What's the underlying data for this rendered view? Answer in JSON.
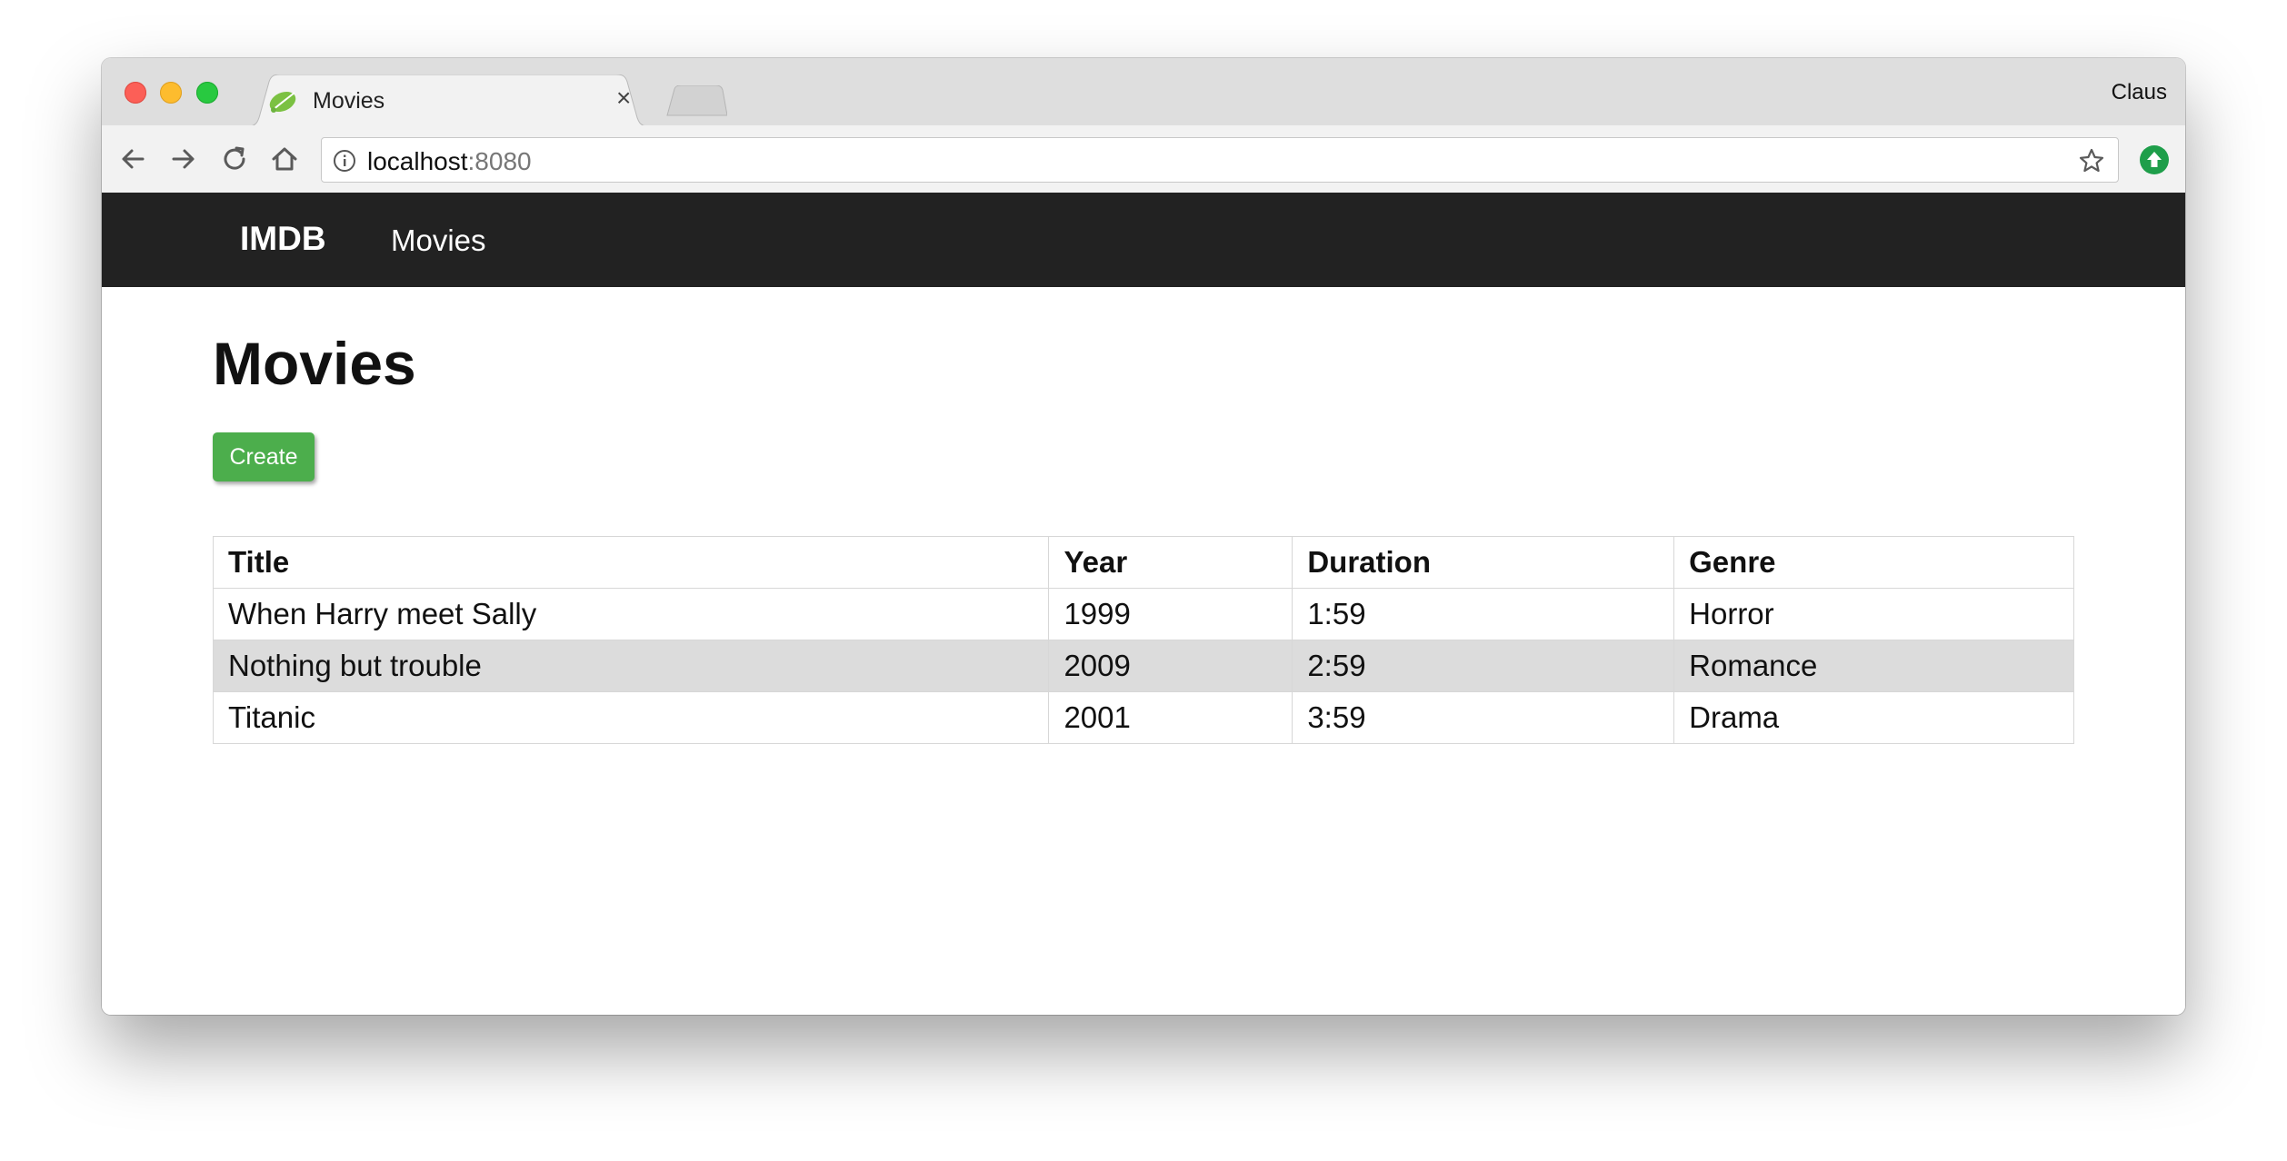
{
  "browser": {
    "tab": {
      "title": "Movies",
      "close_glyph": "×",
      "favicon": "spring-leaf-icon"
    },
    "profile_name": "Claus",
    "address": {
      "host": "localhost",
      "port": ":8080"
    }
  },
  "navbar": {
    "brand": "IMDB",
    "links": [
      {
        "label": "Movies"
      }
    ]
  },
  "main": {
    "title": "Movies",
    "create_label": "Create",
    "table": {
      "headers": [
        "Title",
        "Year",
        "Duration",
        "Genre"
      ],
      "rows": [
        [
          "When Harry meet Sally",
          "1999",
          "1:59",
          "Horror"
        ],
        [
          "Nothing but trouble",
          "2009",
          "2:59",
          "Romance"
        ],
        [
          "Titanic",
          "2001",
          "3:59",
          "Drama"
        ]
      ]
    }
  },
  "colors": {
    "navbar_bg": "#222222",
    "create_button": "#4cae4c",
    "striped_row": "#dcdcdc"
  }
}
